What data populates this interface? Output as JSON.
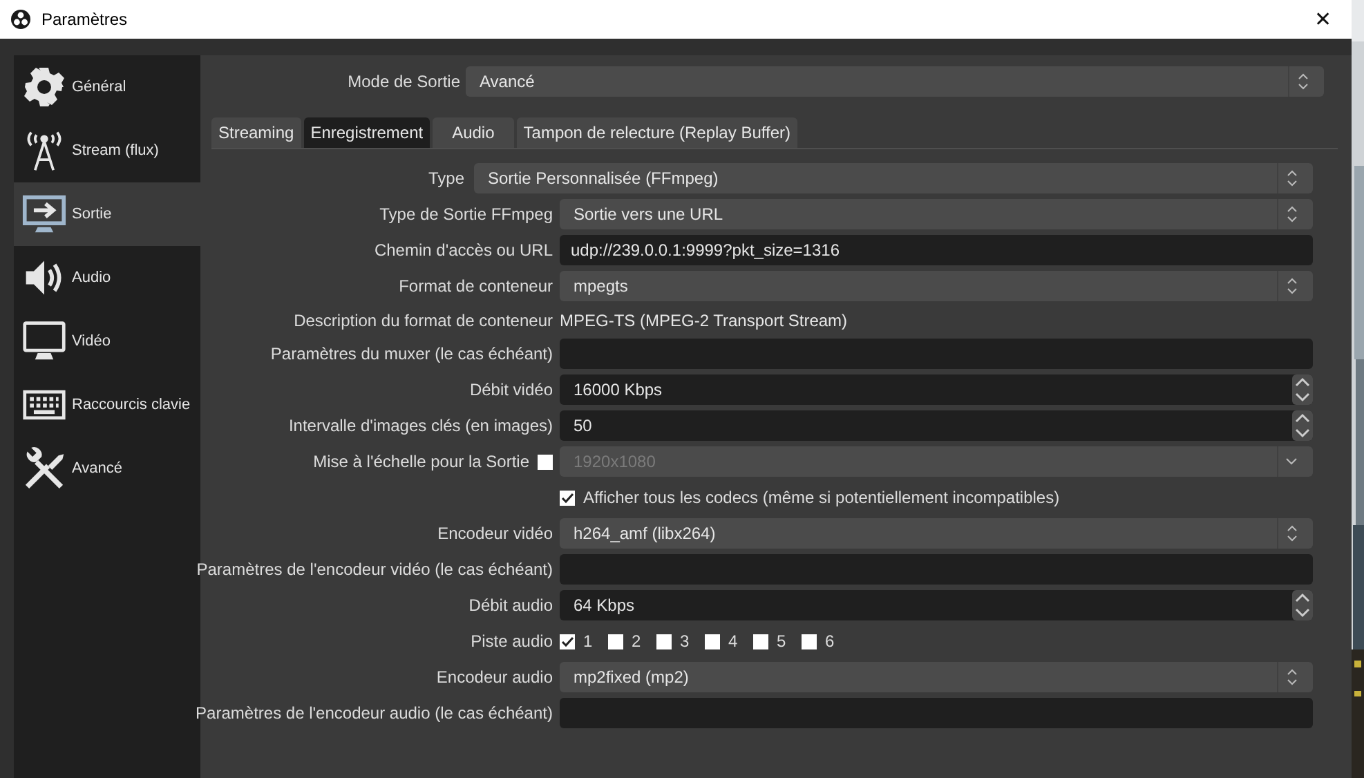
{
  "window": {
    "title": "Paramètres",
    "close": "✕"
  },
  "sidebar": {
    "items": [
      {
        "label": "Général",
        "kind": "gear",
        "selected": false
      },
      {
        "label": "Stream (flux)",
        "kind": "antenna",
        "selected": false
      },
      {
        "label": "Sortie",
        "kind": "output",
        "selected": true
      },
      {
        "label": "Audio",
        "kind": "speaker",
        "selected": false
      },
      {
        "label": "Vidéo",
        "kind": "monitor",
        "selected": false
      },
      {
        "label": "Raccourcis clavie",
        "kind": "keyboard",
        "selected": false
      },
      {
        "label": "Avancé",
        "kind": "tools",
        "selected": false
      }
    ]
  },
  "output_mode": {
    "label": "Mode de Sortie",
    "value": "Avancé"
  },
  "tabs": [
    {
      "label": "Streaming",
      "selected": false
    },
    {
      "label": "Enregistrement",
      "selected": true
    },
    {
      "label": "Audio",
      "selected": false
    },
    {
      "label": "Tampon de relecture (Replay Buffer)",
      "selected": false
    }
  ],
  "type": {
    "label": "Type",
    "value": "Sortie Personnalisée (FFmpeg)"
  },
  "fields": [
    {
      "kind": "combo",
      "label": "Type de Sortie FFmpeg",
      "value": "Sortie vers une URL"
    },
    {
      "kind": "text",
      "label": "Chemin d'accès ou URL",
      "value": "udp://239.0.0.1:9999?pkt_size=1316"
    },
    {
      "kind": "combo",
      "label": "Format de conteneur",
      "value": "mpegts"
    },
    {
      "kind": "info",
      "label": "Description du format de conteneur",
      "value": "MPEG-TS (MPEG-2 Transport Stream)"
    },
    {
      "kind": "text",
      "label": "Paramètres du muxer (le cas échéant)"
    },
    {
      "kind": "spin",
      "label": "Débit vidéo",
      "value": "16000 Kbps"
    },
    {
      "kind": "spin",
      "label": "Intervalle d'images clés (en images)",
      "value": "50"
    },
    {
      "kind": "scale",
      "label": "Mise à l'échelle pour la Sortie",
      "checked": false,
      "value": "1920x1080",
      "disabled": true
    },
    {
      "kind": "checkbox",
      "text": "Afficher tous les codecs (même si potentiellement incompatibles)",
      "checked": true
    },
    {
      "kind": "combo",
      "label": "Encodeur vidéo",
      "value": "h264_amf (libx264)"
    },
    {
      "kind": "text",
      "label": "Paramètres de l'encodeur vidéo (le cas échéant)"
    },
    {
      "kind": "spin",
      "label": "Débit audio",
      "value": "64 Kbps"
    },
    {
      "kind": "tracks",
      "label": "Piste audio",
      "tracks": [
        {
          "label": "1",
          "checked": true
        },
        {
          "label": "2",
          "checked": false
        },
        {
          "label": "3",
          "checked": false
        },
        {
          "label": "4",
          "checked": false
        },
        {
          "label": "5",
          "checked": false
        },
        {
          "label": "6",
          "checked": false
        }
      ]
    },
    {
      "kind": "combo",
      "label": "Encodeur audio",
      "value": "mp2fixed (mp2)"
    },
    {
      "kind": "text",
      "label": "Paramètres de l'encodeur audio (le cas échéant)"
    }
  ]
}
